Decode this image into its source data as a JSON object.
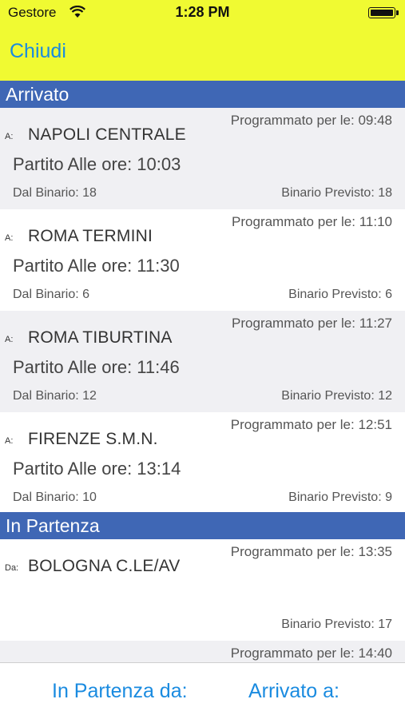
{
  "status_bar": {
    "carrier": "Gestore",
    "time": "1:28 PM"
  },
  "header": {
    "close_label": "Chiudi"
  },
  "sections": [
    {
      "title": "Arrivato",
      "rows": [
        {
          "prefix": "A:",
          "station": "NAPOLI CENTRALE",
          "scheduled": "Programmato per le: 09:48",
          "departed": "Partito Alle ore: 10:03",
          "from_track": "Dal Binario: 18",
          "expected_track": "Binario Previsto: 18"
        },
        {
          "prefix": "A:",
          "station": "ROMA TERMINI",
          "scheduled": "Programmato per le: 11:10",
          "departed": "Partito Alle ore: 11:30",
          "from_track": "Dal Binario: 6",
          "expected_track": "Binario Previsto: 6"
        },
        {
          "prefix": "A:",
          "station": "ROMA TIBURTINA",
          "scheduled": "Programmato per le: 11:27",
          "departed": "Partito Alle ore: 11:46",
          "from_track": "Dal Binario: 12",
          "expected_track": "Binario Previsto: 12"
        },
        {
          "prefix": "A:",
          "station": "FIRENZE S.M.N.",
          "scheduled": "Programmato per le: 12:51",
          "departed": "Partito Alle ore: 13:14",
          "from_track": "Dal Binario: 10",
          "expected_track": "Binario Previsto: 9"
        }
      ]
    },
    {
      "title": "In Partenza",
      "rows": [
        {
          "prefix": "Da:",
          "station": "BOLOGNA C.LE/AV",
          "scheduled": "Programmato per le: 13:35",
          "departed": "",
          "from_track": "",
          "expected_track": "Binario Previsto: 17"
        },
        {
          "prefix": "",
          "station": "",
          "scheduled": "Programmato per le: 14:40",
          "departed": "",
          "from_track": "",
          "expected_track": ""
        }
      ]
    }
  ],
  "bottom_bar": {
    "departing_label": "In Partenza da:",
    "arrived_label": "Arrivato a:"
  },
  "colors": {
    "header_yellow": "#f0fa32",
    "section_blue": "#3f67b5",
    "link_blue": "#1a8be0",
    "row_gray": "#f0f0f3"
  }
}
